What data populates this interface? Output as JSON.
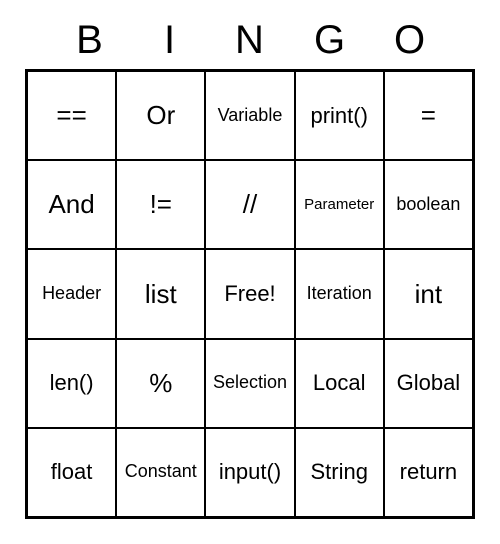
{
  "header": [
    "B",
    "I",
    "N",
    "G",
    "O"
  ],
  "grid": [
    [
      {
        "t": "==",
        "sz": "xl"
      },
      {
        "t": "Or",
        "sz": "xl"
      },
      {
        "t": "Variable",
        "sz": "md"
      },
      {
        "t": "print()",
        "sz": "lg"
      },
      {
        "t": "=",
        "sz": "xl"
      }
    ],
    [
      {
        "t": "And",
        "sz": "xl"
      },
      {
        "t": "!=",
        "sz": "xl"
      },
      {
        "t": "//",
        "sz": "xl"
      },
      {
        "t": "Parameter",
        "sz": "sm"
      },
      {
        "t": "boolean",
        "sz": "md"
      }
    ],
    [
      {
        "t": "Header",
        "sz": "md"
      },
      {
        "t": "list",
        "sz": "xl"
      },
      {
        "t": "Free!",
        "sz": "lg"
      },
      {
        "t": "Iteration",
        "sz": "md"
      },
      {
        "t": "int",
        "sz": "xl"
      }
    ],
    [
      {
        "t": "len()",
        "sz": "lg"
      },
      {
        "t": "%",
        "sz": "xl"
      },
      {
        "t": "Selection",
        "sz": "md"
      },
      {
        "t": "Local",
        "sz": "lg"
      },
      {
        "t": "Global",
        "sz": "lg"
      }
    ],
    [
      {
        "t": "float",
        "sz": "lg"
      },
      {
        "t": "Constant",
        "sz": "md"
      },
      {
        "t": "input()",
        "sz": "lg"
      },
      {
        "t": "String",
        "sz": "lg"
      },
      {
        "t": "return",
        "sz": "lg"
      }
    ]
  ]
}
